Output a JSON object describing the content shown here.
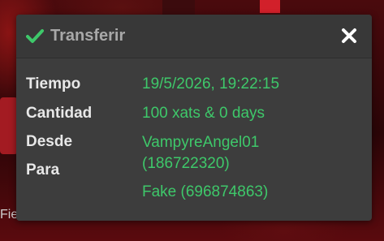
{
  "background": {
    "partial_text": "Fie"
  },
  "dialog": {
    "title": "Transferir",
    "icons": {
      "title_icon": "check-icon",
      "close_icon": "close-icon"
    },
    "colors": {
      "accent": "#3ec86a",
      "label": "#e8e8e8",
      "title": "#a8a8a8",
      "panel": "#3d3d3d"
    },
    "labels": {
      "time": "Tiempo",
      "amount": "Cantidad",
      "from": "Desde",
      "to": "Para"
    },
    "values": {
      "time": "19/5/2026, 19:22:15",
      "amount": "100 xats & 0 days",
      "from_line1": "VampyreAngel01",
      "from_line2": "(186722320)",
      "to": "Fake (696874863)"
    }
  }
}
